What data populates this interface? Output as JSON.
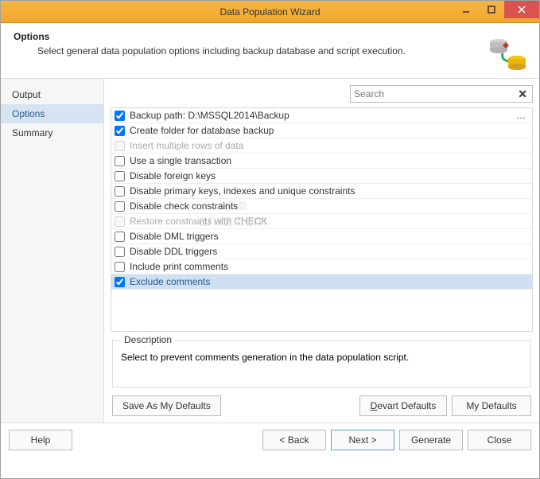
{
  "title": "Data Population Wizard",
  "header": {
    "title": "Options",
    "subtitle": "Select general data population options including backup database and script execution."
  },
  "sidebar": {
    "items": [
      {
        "label": "Output",
        "active": false
      },
      {
        "label": "Options",
        "active": true
      },
      {
        "label": "Summary",
        "active": false
      }
    ]
  },
  "search": {
    "placeholder": "Search",
    "value": "",
    "clear": "✕"
  },
  "options": [
    {
      "label": "Backup path: D:\\MSSQL2014\\Backup",
      "checked": true,
      "disabled": false,
      "hasMore": true
    },
    {
      "label": "Create folder for database backup",
      "checked": true,
      "disabled": false
    },
    {
      "label": "Insert multiple rows of data",
      "checked": false,
      "disabled": true
    },
    {
      "label": "Use a single transaction",
      "checked": false,
      "disabled": false
    },
    {
      "label": "Disable foreign keys",
      "checked": false,
      "disabled": false
    },
    {
      "label": "Disable primary keys, indexes and unique constraints",
      "checked": false,
      "disabled": false
    },
    {
      "label": "Disable check constraints",
      "checked": false,
      "disabled": false
    },
    {
      "label": "Restore constraints with CHECK",
      "checked": false,
      "disabled": true
    },
    {
      "label": "Disable DML triggers",
      "checked": false,
      "disabled": false
    },
    {
      "label": "Disable DDL triggers",
      "checked": false,
      "disabled": false
    },
    {
      "label": "Include print comments",
      "checked": false,
      "disabled": false
    },
    {
      "label": "Exclude comments",
      "checked": true,
      "disabled": false,
      "selected": true
    }
  ],
  "description": {
    "legend": "Description",
    "text": "Select to prevent comments generation in the data population script."
  },
  "defaultsButtons": {
    "saveAs": "Save As My Defaults",
    "devart": "Devart Defaults",
    "my": "My Defaults"
  },
  "footer": {
    "help": "Help",
    "back": "< Back",
    "next": "Next >",
    "generate": "Generate",
    "close": "Close"
  },
  "watermark": {
    "line1": "安下载",
    "line2": "anxz.com"
  }
}
